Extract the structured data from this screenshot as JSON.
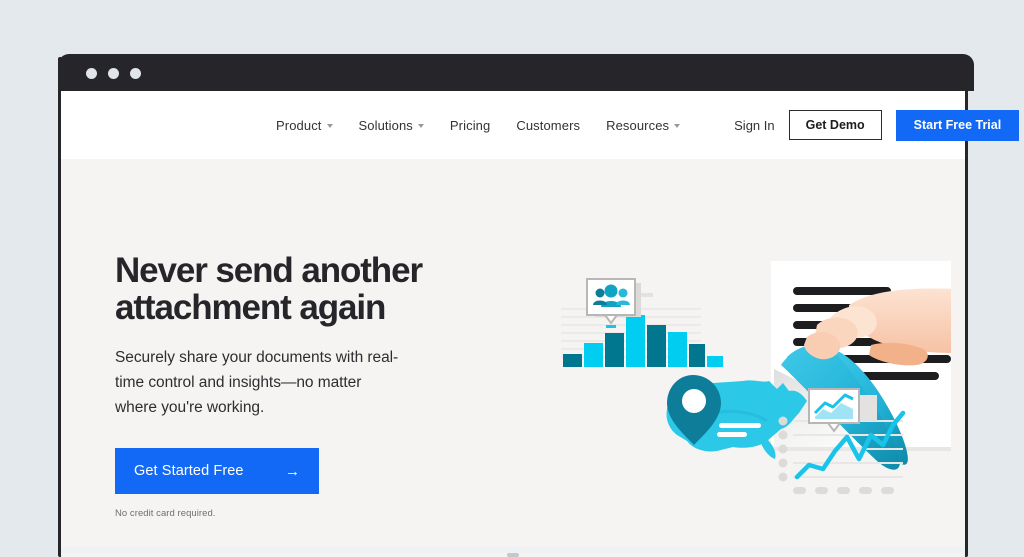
{
  "window": {
    "traffic_lights": [
      "close",
      "minimize",
      "maximize"
    ]
  },
  "nav": {
    "links": [
      {
        "label": "Product",
        "has_dropdown": true
      },
      {
        "label": "Solutions",
        "has_dropdown": true
      },
      {
        "label": "Pricing",
        "has_dropdown": false
      },
      {
        "label": "Customers",
        "has_dropdown": false
      },
      {
        "label": "Resources",
        "has_dropdown": true
      }
    ],
    "signin_label": "Sign In",
    "demo_button_label": "Get Demo",
    "trial_button_label": "Start Free Trial"
  },
  "hero": {
    "headline": "Never send another\nattachment again",
    "subhead": "Securely share your documents with real-\ntime control and insights—no matter\nwhere you're working.",
    "cta_label": "Get Started Free",
    "cta_arrow": "→",
    "cta_note": "No credit card required."
  },
  "illustration": {
    "alt": "Document with peeling page corner, analytics bar chart, US map with location pin, and trend line chart",
    "bar_chart": {
      "type": "bar",
      "values": [
        18,
        38,
        58,
        82,
        66,
        52,
        34,
        14
      ],
      "colors": [
        "#01778f",
        "#00cdf0",
        "#01778f",
        "#00cdf0",
        "#01778f",
        "#00cdf0",
        "#01778f",
        "#00cdf0"
      ],
      "tooltip_icon": "people-icon"
    },
    "line_chart": {
      "type": "line",
      "values": [
        8,
        20,
        16,
        30,
        44,
        26,
        46,
        38,
        62,
        78
      ],
      "color": "#19c4ea",
      "tooltip_icon": "chart-icon"
    },
    "map": {
      "region": "United States",
      "fill": "#2cc8e8",
      "pin_color": "#0e7d99"
    },
    "document": {
      "text_line_count": 6,
      "page_fill": "#ffffff",
      "peel_color": "#2ab9dd",
      "hand_color": "#fbd8c3"
    }
  },
  "colors": {
    "page_background": "#e3e9ec",
    "frame": "#26262a",
    "navbar": "#ffffff",
    "hero_background": "#f5f4f2",
    "accent_blue": "#1269f5",
    "accent_cyan": "#00cdf0",
    "accent_teal": "#01778f",
    "text_dark": "#26262a",
    "text_muted": "#6f6f74"
  }
}
